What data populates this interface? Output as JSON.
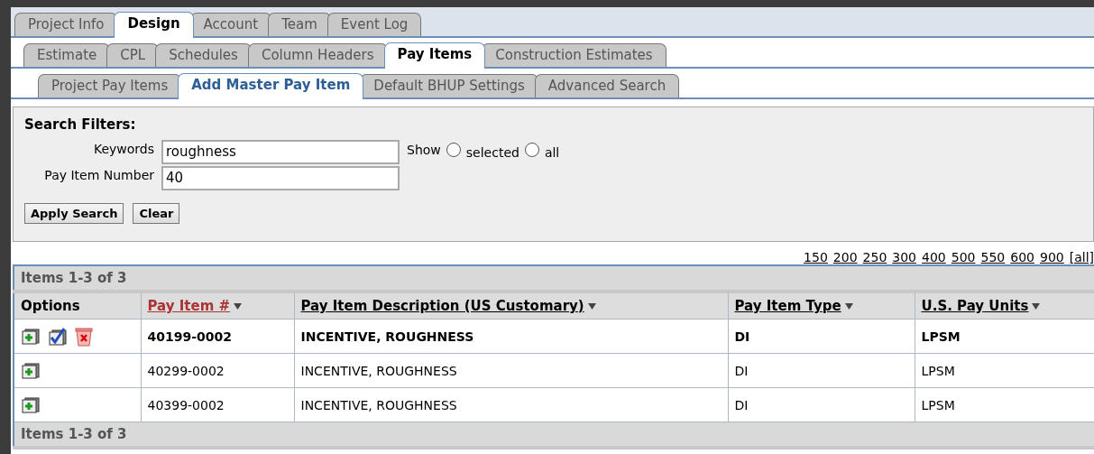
{
  "tab_rows": [
    {
      "tabs": [
        {
          "label": "Project Info",
          "selected": false
        },
        {
          "label": "Design",
          "selected": true
        },
        {
          "label": "Account",
          "selected": false
        },
        {
          "label": "Team",
          "selected": false
        },
        {
          "label": "Event Log",
          "selected": false
        }
      ]
    },
    {
      "tabs": [
        {
          "label": "Estimate",
          "selected": false
        },
        {
          "label": "CPL",
          "selected": false
        },
        {
          "label": "Schedules",
          "selected": false
        },
        {
          "label": "Column Headers",
          "selected": false
        },
        {
          "label": "Pay Items",
          "selected": true
        },
        {
          "label": "Construction Estimates",
          "selected": false
        }
      ]
    },
    {
      "tabs": [
        {
          "label": "Project Pay Items",
          "selected": false
        },
        {
          "label": "Add Master Pay Item",
          "selected": true
        },
        {
          "label": "Default BHUP Settings",
          "selected": false
        },
        {
          "label": "Advanced Search",
          "selected": false
        }
      ]
    }
  ],
  "search_filters": {
    "title": "Search Filters:",
    "keywords": {
      "label": "Keywords",
      "value": "roughness"
    },
    "pay_item_number": {
      "label": "Pay Item Number",
      "value": "40"
    },
    "show": {
      "label": "Show",
      "options": [
        {
          "label": "selected",
          "selected": false
        },
        {
          "label": "all",
          "selected": false
        }
      ]
    },
    "buttons": [
      "Apply Search",
      "Clear"
    ]
  },
  "page_sizes": [
    "150",
    "200",
    "250",
    "300",
    "400",
    "500",
    "550",
    "600",
    "900",
    "[all]"
  ],
  "table": {
    "summary_top": "Items 1-3 of 3",
    "columns": [
      {
        "label": "Options",
        "kind": "plain"
      },
      {
        "label": "Pay Item #",
        "kind": "sort",
        "sorted": true
      },
      {
        "label": "Pay Item Description (US Customary)",
        "kind": "sort",
        "sorted": false
      },
      {
        "label": "Pay Item Type",
        "kind": "sort",
        "sorted": false
      },
      {
        "label": "U.S. Pay Units",
        "kind": "sort",
        "sorted": false
      }
    ],
    "rows": [
      {
        "selected": true,
        "cells": [
          "",
          "40199-0002",
          "INCENTIVE, ROUGHNESS",
          "DI",
          "LPSM"
        ]
      },
      {
        "selected": false,
        "cells": [
          "",
          "40299-0002",
          "INCENTIVE, ROUGHNESS",
          "DI",
          "LPSM"
        ]
      },
      {
        "selected": false,
        "cells": [
          "",
          "40399-0002",
          "INCENTIVE, ROUGHNESS",
          "DI",
          "LPSM"
        ]
      }
    ],
    "summary_bottom": "Items 1-3 of 3"
  }
}
